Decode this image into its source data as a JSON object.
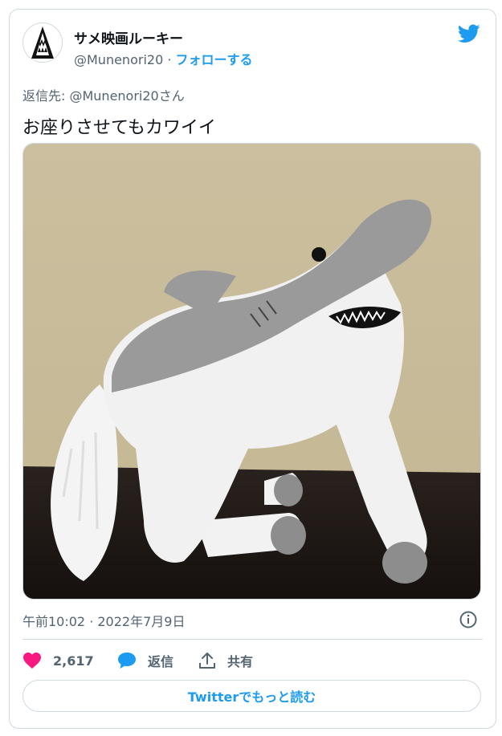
{
  "account": {
    "display_name": "サメ映画ルーキー",
    "handle": "@Munenori20",
    "separator": "·",
    "follow_label": "フォローする"
  },
  "tweet": {
    "reply_to": "返信先: @Munenori20さん",
    "text": "お座りさせてもカワイイ",
    "timestamp": "午前10:02 · 2022年7月9日"
  },
  "actions": {
    "likes": "2,617",
    "reply_label": "返信",
    "share_label": "共有"
  },
  "read_more_label": "Twitterでもっと読む",
  "icons": {
    "brand": "twitter-bird-icon",
    "info": "info-icon",
    "like": "heart-icon",
    "reply": "speech-bubble-icon",
    "share": "upload-icon"
  },
  "colors": {
    "accent": "#1d9bf0",
    "like": "#f91880",
    "text": "#0f1419",
    "muted": "#536471",
    "border": "#cfd9de"
  }
}
